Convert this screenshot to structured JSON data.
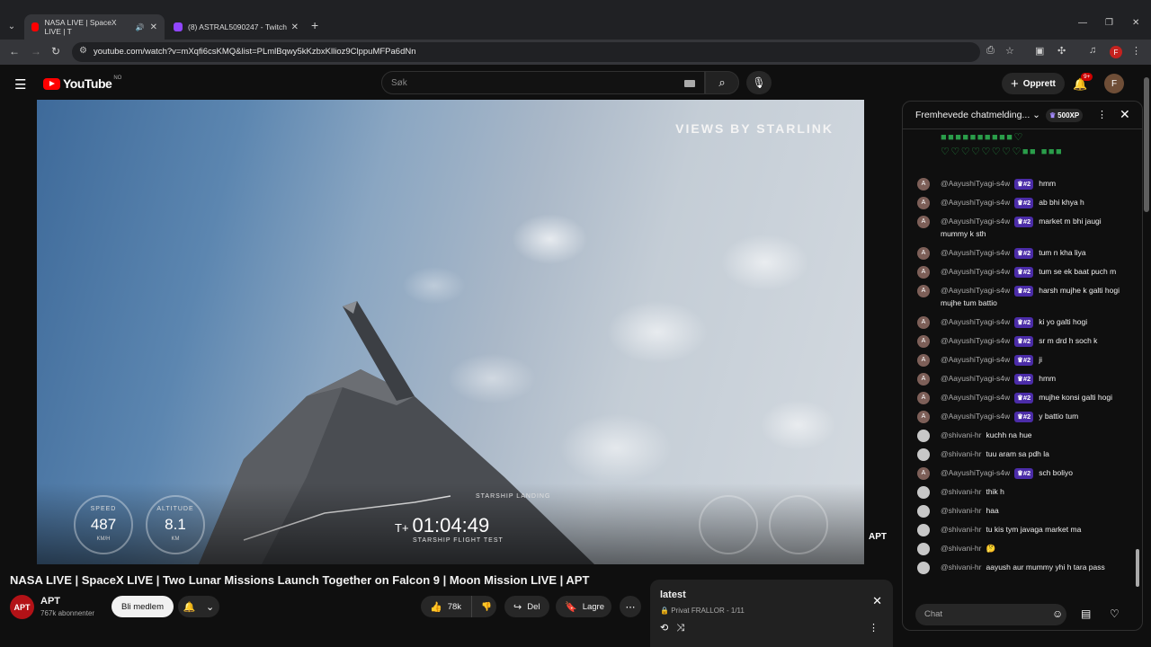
{
  "browser": {
    "tabs": [
      {
        "label": "NASA LIVE | SpaceX LIVE | T",
        "favicon_color": "#ff0000"
      },
      {
        "label": "(8) ASTRAL5090247 - Twitch",
        "favicon_color": "#9146ff"
      }
    ],
    "url": "youtube.com/watch?v=mXqfi6csKMQ&list=PLmlBqwy5kKzbxKllioz9ClppuMFPa6dNn",
    "profile_initial": "F"
  },
  "youtube": {
    "logo_text": "YouTube",
    "logo_region": "NO",
    "search_placeholder": "Søk",
    "create_label": "Opprett",
    "notif_badge": "9+",
    "avatar_initial": "F"
  },
  "video": {
    "overlay_text": "VIEWS BY STARLINK",
    "speed": {
      "label": "SPEED",
      "value": "487",
      "unit": "KM/H"
    },
    "altitude": {
      "label": "ALTITUDE",
      "value": "8.1",
      "unit": "KM"
    },
    "timer_prefix": "T+",
    "timer": "01:04:49",
    "flight_test": "STARSHIP FLIGHT TEST",
    "landing_label": "STARSHIP LANDING",
    "channel_watermark": "APT"
  },
  "meta": {
    "title": "NASA LIVE | SpaceX LIVE | Two Lunar Missions Launch Together on Falcon 9 | Moon Mission LIVE | APT",
    "channel_avatar": "APT",
    "channel_name": "APT",
    "subscribers": "767k abonnenter",
    "member_label": "Bli medlem",
    "likes": "78k",
    "share_label": "Del",
    "save_label": "Lagre"
  },
  "playlist": {
    "title": "latest",
    "meta": "Privat  FRALLOR - 1/11"
  },
  "chat": {
    "header": "Fremhevede chatmelding...",
    "xp": "500XP",
    "input_placeholder": "Chat",
    "messages": [
      {
        "user": "@AayushiTyagi-s4w",
        "badge": "#2",
        "text": "hmm",
        "av": "A",
        "grey": false
      },
      {
        "user": "@AayushiTyagi-s4w",
        "badge": "#2",
        "text": "ab bhi khya h",
        "av": "A",
        "grey": false
      },
      {
        "user": "@AayushiTyagi-s4w",
        "badge": "#2",
        "text": "market m bhi jaugi mummy k sth",
        "av": "A",
        "grey": false
      },
      {
        "user": "@AayushiTyagi-s4w",
        "badge": "#2",
        "text": "tum n kha liya",
        "av": "A",
        "grey": false
      },
      {
        "user": "@AayushiTyagi-s4w",
        "badge": "#2",
        "text": "tum se ek baat puch m",
        "av": "A",
        "grey": false
      },
      {
        "user": "@AayushiTyagi-s4w",
        "badge": "#2",
        "text": "harsh mujhe k galti hogi mujhe tum battio",
        "av": "A",
        "grey": false
      },
      {
        "user": "@AayushiTyagi-s4w",
        "badge": "#2",
        "text": "ki yo galti hogi",
        "av": "A",
        "grey": false
      },
      {
        "user": "@AayushiTyagi-s4w",
        "badge": "#2",
        "text": "sr m drd h soch k",
        "av": "A",
        "grey": false
      },
      {
        "user": "@AayushiTyagi-s4w",
        "badge": "#2",
        "text": "ji",
        "av": "A",
        "grey": false
      },
      {
        "user": "@AayushiTyagi-s4w",
        "badge": "#2",
        "text": "hmm",
        "av": "A",
        "grey": false
      },
      {
        "user": "@AayushiTyagi-s4w",
        "badge": "#2",
        "text": "mujhe konsi galti hogi",
        "av": "A",
        "grey": false
      },
      {
        "user": "@AayushiTyagi-s4w",
        "badge": "#2",
        "text": "y battio tum",
        "av": "A",
        "grey": false
      },
      {
        "user": "@shivani-hr",
        "badge": "",
        "text": "kuchh na hue",
        "av": "",
        "grey": true
      },
      {
        "user": "@shivani-hr",
        "badge": "",
        "text": "tuu aram sa pdh la",
        "av": "",
        "grey": true
      },
      {
        "user": "@AayushiTyagi-s4w",
        "badge": "#2",
        "text": "sch boliyo",
        "av": "A",
        "grey": false
      },
      {
        "user": "@shivani-hr",
        "badge": "",
        "text": "thik h",
        "av": "",
        "grey": true
      },
      {
        "user": "@shivani-hr",
        "badge": "",
        "text": "haa",
        "av": "",
        "grey": true
      },
      {
        "user": "@shivani-hr",
        "badge": "",
        "text": "tu kis tym javaga market ma",
        "av": "",
        "grey": true
      },
      {
        "user": "@shivani-hr",
        "badge": "",
        "text": "🤔",
        "av": "",
        "grey": true
      },
      {
        "user": "@shivani-hr",
        "badge": "",
        "text": "aayush aur mummy yhi h tara pass",
        "av": "",
        "grey": true
      }
    ]
  }
}
